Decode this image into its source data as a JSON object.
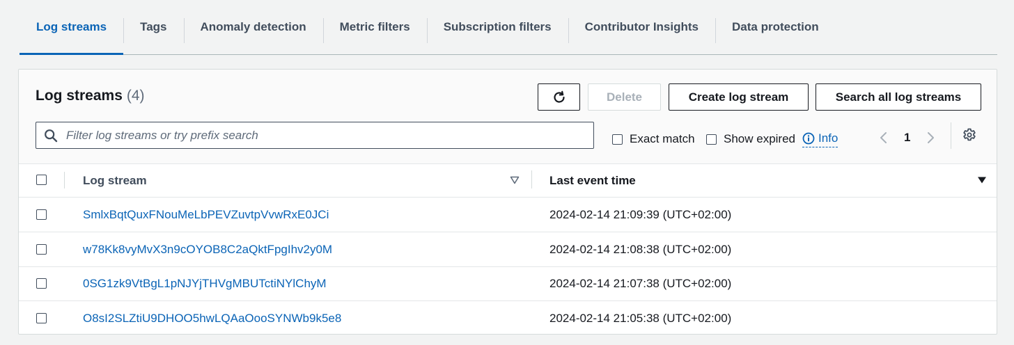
{
  "tabs": [
    {
      "label": "Log streams",
      "active": true
    },
    {
      "label": "Tags",
      "active": false
    },
    {
      "label": "Anomaly detection",
      "active": false
    },
    {
      "label": "Metric filters",
      "active": false
    },
    {
      "label": "Subscription filters",
      "active": false
    },
    {
      "label": "Contributor Insights",
      "active": false
    },
    {
      "label": "Data protection",
      "active": false
    }
  ],
  "panel": {
    "title": "Log streams",
    "count": "(4)",
    "refresh_icon": "refresh-icon",
    "delete_label": "Delete",
    "create_label": "Create log stream",
    "search_all_label": "Search all log streams"
  },
  "filter": {
    "placeholder": "Filter log streams or try prefix search",
    "value": "",
    "icon": "search-icon"
  },
  "options": {
    "exact_match_label": "Exact match",
    "show_expired_label": "Show expired",
    "info_label": "Info"
  },
  "pagination": {
    "current_page": "1"
  },
  "table": {
    "columns": [
      "Log stream",
      "Last event time"
    ],
    "rows": [
      {
        "stream": "SmlxBqtQuxFNouMeLbPEVZuvtpVvwRxE0JCi",
        "time": "2024-02-14 21:09:39 (UTC+02:00)"
      },
      {
        "stream": "w78Kk8vyMvX3n9cOYOB8C2aQktFpgIhv2y0M",
        "time": "2024-02-14 21:08:38 (UTC+02:00)"
      },
      {
        "stream": "0SG1zk9VtBgL1pNJYjTHVgMBUTctiNYlChyM",
        "time": "2024-02-14 21:07:38 (UTC+02:00)"
      },
      {
        "stream": "O8sI2SLZtiU9DHOO5hwLQAaOooSYNWb9k5e8",
        "time": "2024-02-14 21:05:38 (UTC+02:00)"
      }
    ]
  },
  "colors": {
    "link": "#0b64b6",
    "text": "#16191f",
    "muted": "#414d5c",
    "disabled": "#a8b0b8"
  }
}
